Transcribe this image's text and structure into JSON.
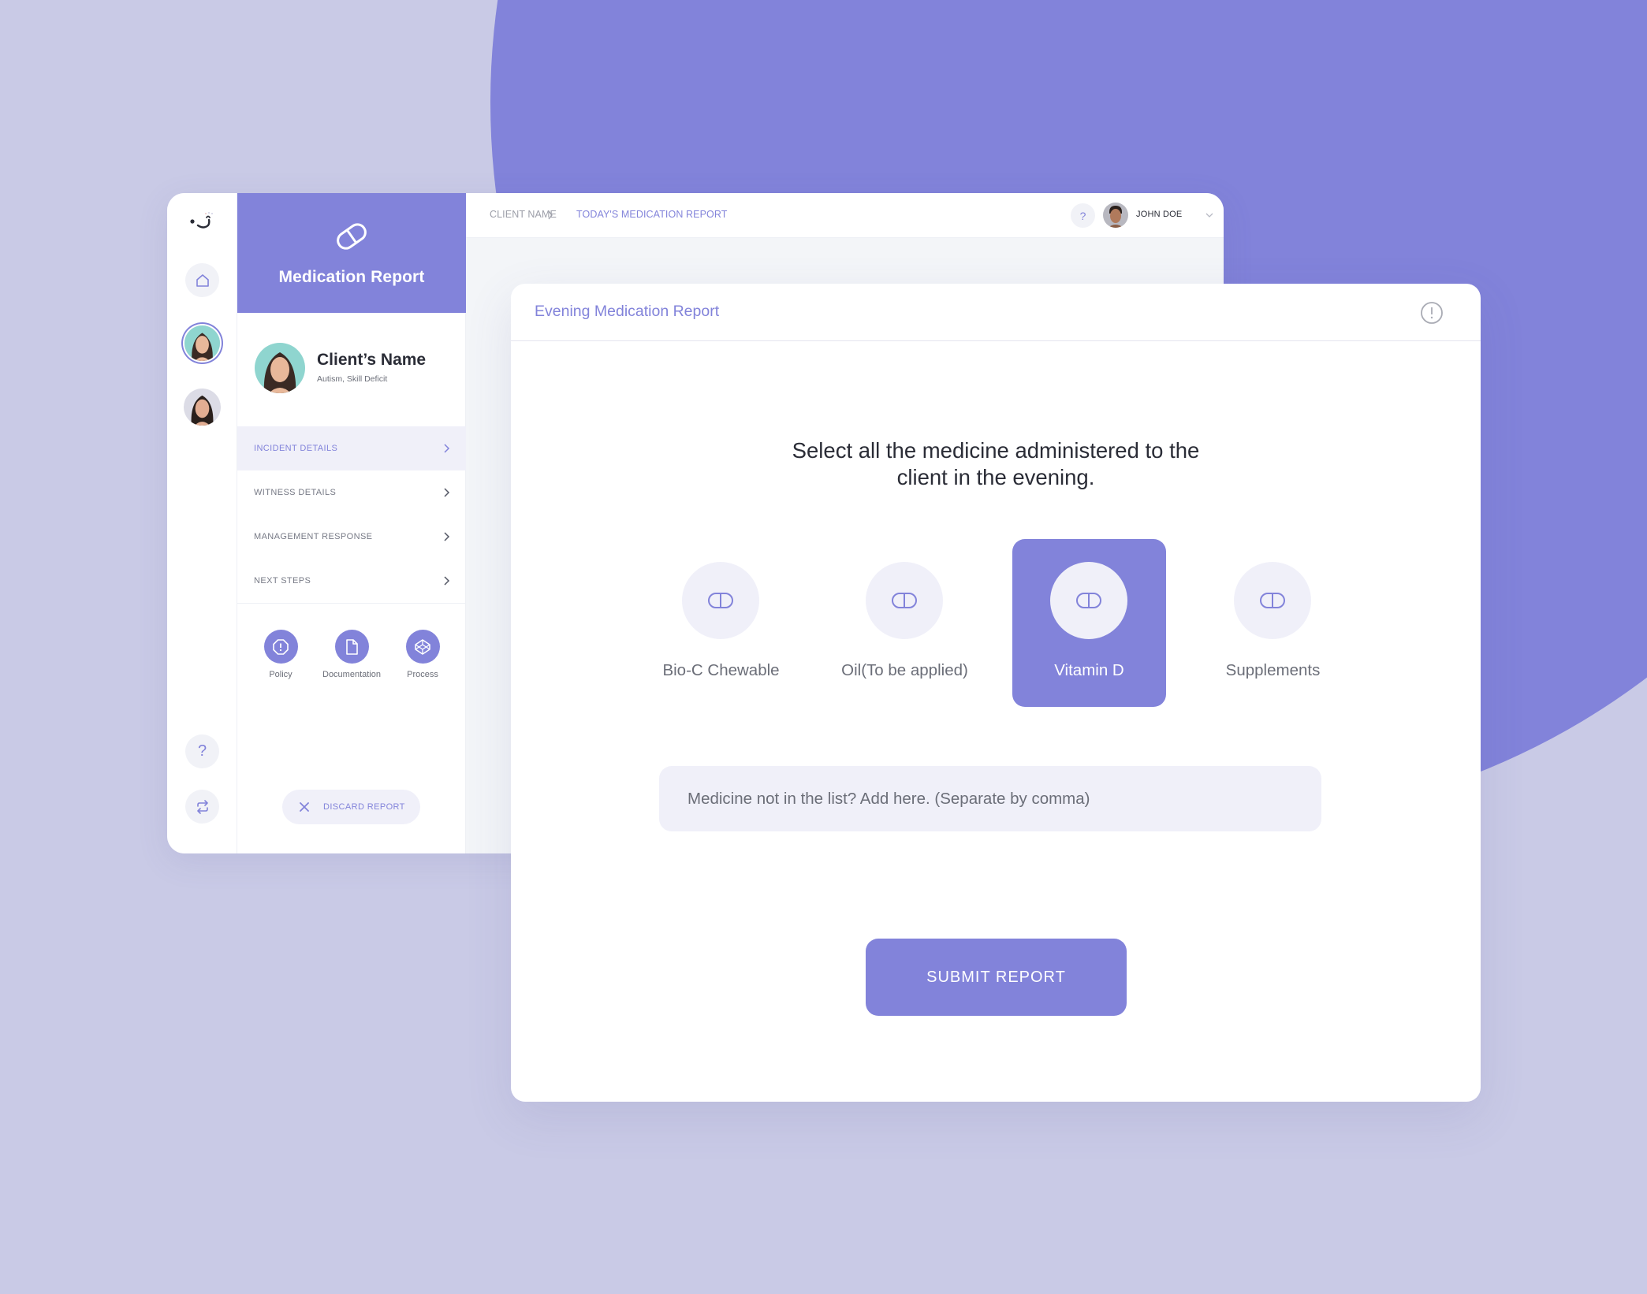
{
  "theme": {
    "accent": "#8283da",
    "background": "#c9cae6",
    "soft": "#f0f0f9"
  },
  "rail": {
    "logo": "smile-logo",
    "items": [
      {
        "name": "home",
        "icon": "home-icon"
      },
      {
        "name": "client-1",
        "icon": "avatar",
        "active": true
      },
      {
        "name": "client-2",
        "icon": "avatar",
        "active": false
      },
      {
        "name": "help",
        "icon": "question-icon"
      },
      {
        "name": "switch",
        "icon": "swap-arrows-icon"
      }
    ]
  },
  "side_panel": {
    "title": "Medication Report",
    "client": {
      "name": "Client’s Name",
      "description": "Autism, Skill Deficit"
    },
    "menu": [
      {
        "label": "INCIDENT DETAILS",
        "active": true
      },
      {
        "label": "WITNESS DETAILS",
        "active": false
      },
      {
        "label": "MANAGEMENT RESPONSE",
        "active": false
      },
      {
        "label": "NEXT STEPS",
        "active": false
      }
    ],
    "quick_links": [
      {
        "label": "Policy",
        "icon": "alert-octagon-icon"
      },
      {
        "label": "Documentation",
        "icon": "document-icon"
      },
      {
        "label": "Process",
        "icon": "codepen-cube-icon"
      }
    ],
    "discard_label": "DISCARD REPORT"
  },
  "topbar": {
    "breadcrumb": [
      "CLIENT NAME",
      "TODAY'S MEDICATION REPORT"
    ],
    "help": "?",
    "user_name": "JOHN DOE"
  },
  "card": {
    "title": "Evening Medication Report",
    "question_line1": "Select all the medicine administered to the",
    "question_line2": "client in the evening.",
    "options": [
      {
        "label": "Bio-C Chewable",
        "selected": false
      },
      {
        "label": "Oil(To be applied)",
        "selected": false
      },
      {
        "label": "Vitamin D",
        "selected": true
      },
      {
        "label": "Supplements",
        "selected": false
      }
    ],
    "add_input": {
      "value": "",
      "placeholder": "Medicine not in the list? Add here. (Separate by comma)"
    },
    "submit_label": "SUBMIT REPORT"
  }
}
